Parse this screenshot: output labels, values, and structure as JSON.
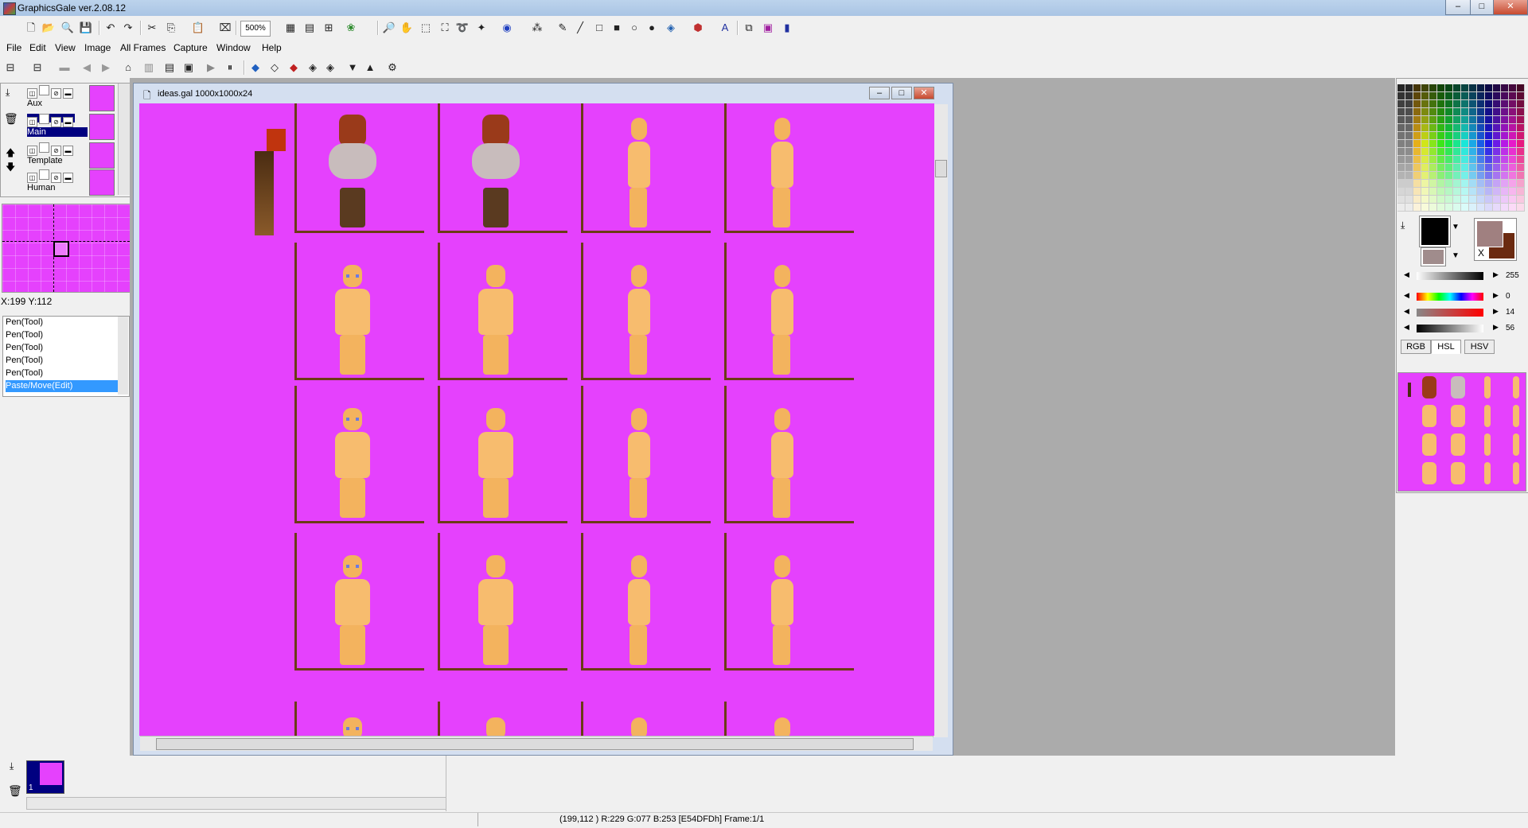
{
  "app": {
    "title": "GraphicsGale ver.2.08.12"
  },
  "window_buttons": {
    "minimize": "‒",
    "maximize": "□",
    "close": "✕"
  },
  "toolbar": {
    "zoom": "500%"
  },
  "menu": [
    "File",
    "Edit",
    "View",
    "Image",
    "All Frames",
    "Capture",
    "Window",
    "Help"
  ],
  "layers": [
    {
      "name": "Aux"
    },
    {
      "name": "Main"
    },
    {
      "name": "Template"
    },
    {
      "name": "Human"
    }
  ],
  "navigator": {
    "coords": "X:199 Y:112"
  },
  "history": [
    "Pen(Tool)",
    "Pen(Tool)",
    "Pen(Tool)",
    "Pen(Tool)",
    "Pen(Tool)",
    "Paste/Move(Edit)"
  ],
  "document": {
    "title": "ideas.gal 1000x1000x24"
  },
  "color_panel": {
    "value1": "255",
    "value2": "0",
    "value3": "14",
    "value4": "56",
    "tabs": [
      "RGB",
      "HSL",
      "HSV"
    ],
    "primary_color": "#000000",
    "secondary_color": "#a08c8c",
    "fg_color": "#a08080",
    "bg_color": "#6b2a10",
    "swap_label": "X"
  },
  "frames": {
    "number": "1"
  },
  "status": {
    "text": "(199,112 ) R:229 G:077 B:253  [E54DFDh]  Frame:1/1"
  },
  "colors": {
    "canvas": "#e541fd",
    "border": "#6b3b16",
    "skin": "#f7bc6e"
  }
}
